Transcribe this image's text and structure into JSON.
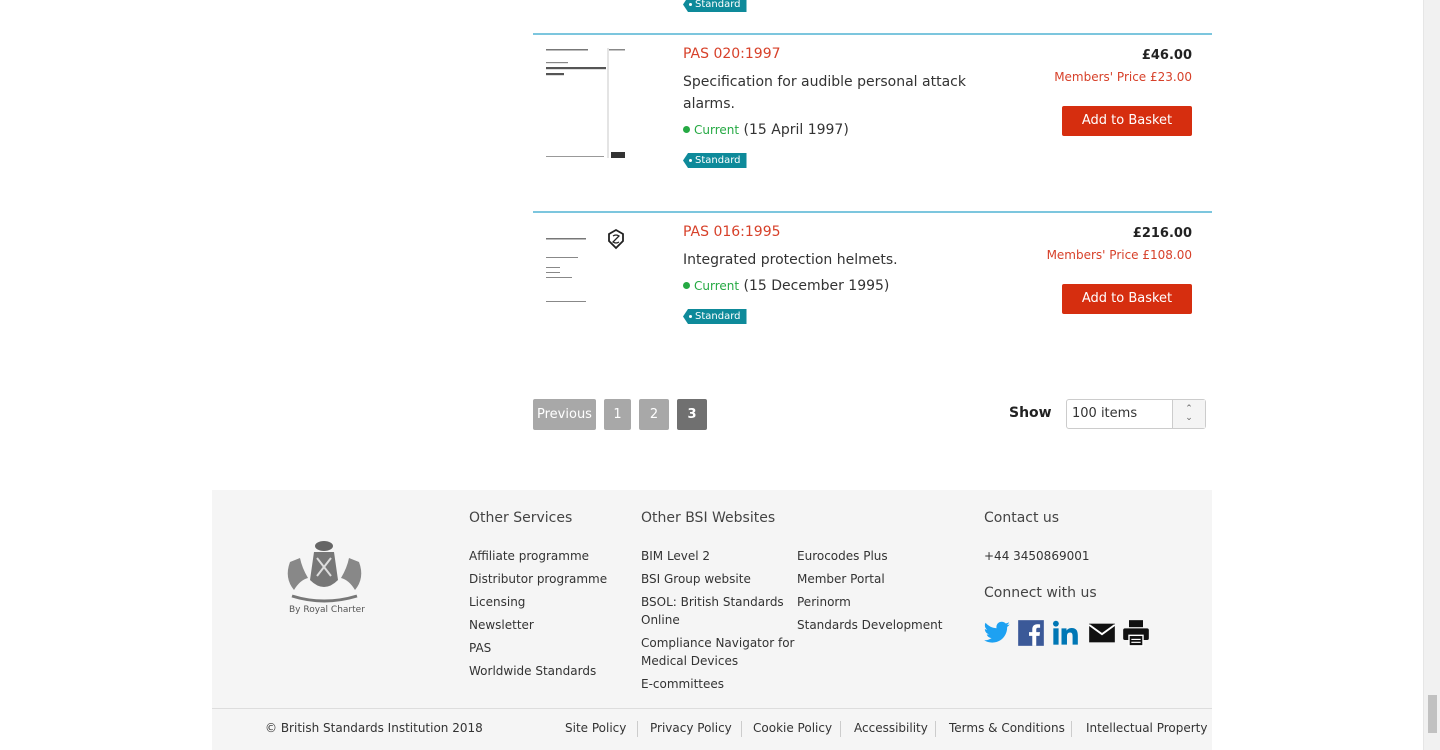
{
  "products": [
    {
      "tag": "Standard"
    },
    {
      "code": "PAS 020:1997",
      "description": "Specification for audible personal attack alarms.",
      "status": "Current",
      "date": "(15 April 1997)",
      "price": "£46.00",
      "members_price": "Members' Price £23.00",
      "button": "Add to Basket",
      "tag": "Standard",
      "thumb": {
        "header_left": "PRIVATE ADMINISTRATION SERIES",
        "header_right": "PAS 020:1997",
        "line1": "Specification for",
        "line2": "Audible personal attack",
        "line3": "alarms"
      }
    },
    {
      "code": "PAS 016:1995",
      "description": "Integrated protection helmets.",
      "status": "Current",
      "date": "(15 December 1995)",
      "price": "£216.00",
      "members_price": "Members' Price £108.00",
      "button": "Add to Basket",
      "tag": "Standard",
      "thumb": {
        "title": "Integrated Protection Helmets",
        "sub": "PAS 016 : 1995 ISSUE 1",
        "p": "P",
        "a": "A",
        "s": "S",
        "line_p": "roduct",
        "line_a": "pproval",
        "line_s": "pecification",
        "footer": "LpCB Product Certification"
      }
    }
  ],
  "pagination": {
    "previous": "Previous",
    "pages": [
      "1",
      "2",
      "3"
    ],
    "active": "3",
    "show_label": "Show",
    "show_value": "100 items",
    "arrows": [
      "⌃",
      "⌄"
    ]
  },
  "footer": {
    "logo_caption": "By Royal Charter",
    "other_services": {
      "title": "Other Services",
      "links": [
        "Affiliate programme",
        "Distributor programme",
        "Licensing",
        "Newsletter",
        "PAS",
        "Worldwide Standards"
      ]
    },
    "other_websites": {
      "title": "Other BSI Websites",
      "links_left": [
        "BIM Level 2",
        "BSI Group website",
        "BSOL: British Standards",
        "Online",
        "Compliance Navigator for",
        "Medical Devices",
        "E-committees"
      ],
      "links_right": [
        "Eurocodes Plus",
        "Member Portal",
        "Perinorm",
        "Standards Development"
      ]
    },
    "contact": {
      "title": "Contact us",
      "phone": "+44 3450869001",
      "connect": "Connect with us"
    },
    "copyright": "© British Standards Institution 2018",
    "policies": [
      "Site Policy",
      "Privacy Policy",
      "Cookie Policy",
      "Accessibility",
      "Terms & Conditions",
      "Intellectual Property"
    ]
  },
  "colors": {
    "accent": "#d62e0f",
    "price_red": "#d7412a",
    "tag": "#0e8a9a",
    "current_green": "#25a943",
    "rule": "#7cc6de"
  }
}
